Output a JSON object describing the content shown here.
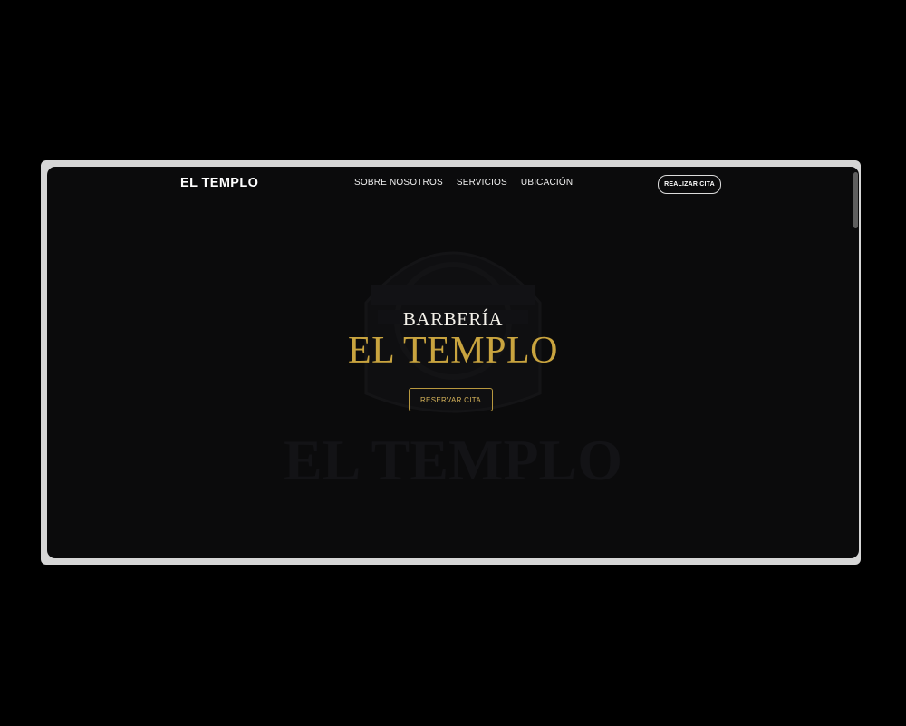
{
  "nav": {
    "brand": "EL TEMPLO",
    "links": [
      "SOBRE NOSOTROS",
      "SERVICIOS",
      "UBICACIÓN"
    ],
    "cta": "REALIZAR CITA"
  },
  "hero": {
    "subtitle": "BARBERÍA",
    "title": "EL TEMPLO",
    "button": "RESERVAR CITA"
  },
  "background": {
    "watermark_text": "EL TEMPLO",
    "watermark_icon": "barber-crest-logo"
  },
  "colors": {
    "background": "#0b0b0c",
    "accent_gold": "#c9a43f",
    "text_light": "#f4f1ea"
  }
}
